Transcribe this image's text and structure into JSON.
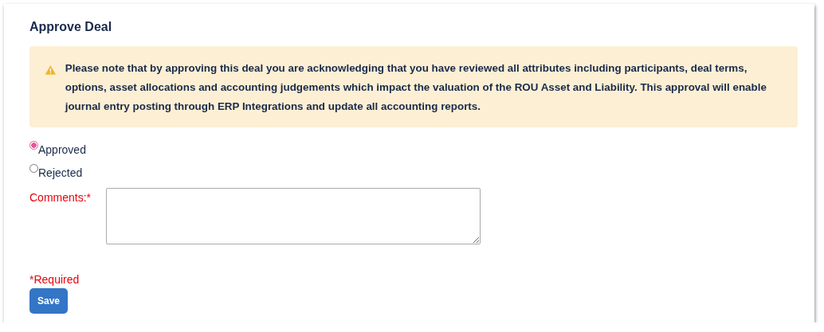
{
  "title": "Approve Deal",
  "alert": {
    "text": "Please note that by approving this deal you are acknowledging that you have reviewed all attributes including participants, deal terms, options, asset allocations and accounting judgements which impact the valuation of the ROU Asset and Liability. This approval will enable journal entry posting through ERP Integrations and update all accounting reports."
  },
  "options": [
    {
      "label": "Approved",
      "selected": true
    },
    {
      "label": "Rejected",
      "selected": false
    }
  ],
  "comments": {
    "label": "Comments:*"
  },
  "required_note": "*Required",
  "buttons": [
    "Save"
  ]
}
